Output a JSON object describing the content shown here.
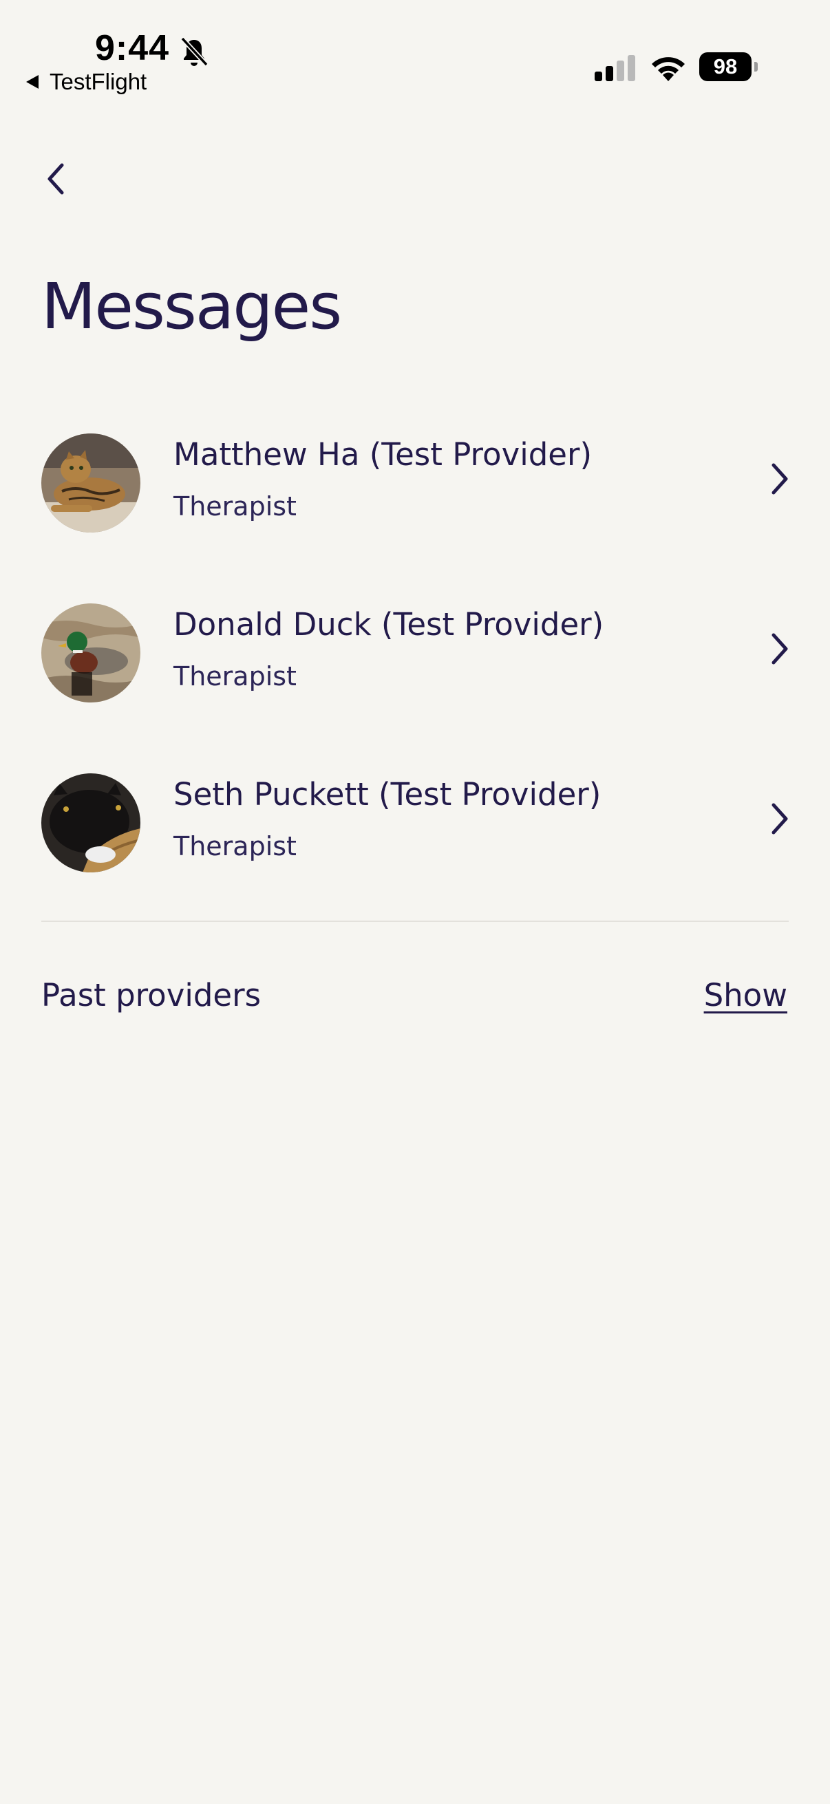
{
  "status_bar": {
    "time": "9:44",
    "back_app": "TestFlight",
    "battery": "98",
    "icons": [
      "bell-slash-icon",
      "cellular-signal-icon",
      "wifi-icon",
      "battery-icon"
    ]
  },
  "nav": {
    "back_icon": "chevron-left-icon"
  },
  "page": {
    "title": "Messages"
  },
  "providers": [
    {
      "name": "Matthew Ha (Test Provider)",
      "role": "Therapist",
      "avatar": "cat-photo"
    },
    {
      "name": "Donald Duck (Test Provider)",
      "role": "Therapist",
      "avatar": "duck-photo"
    },
    {
      "name": "Seth Puckett (Test Provider)",
      "role": "Therapist",
      "avatar": "black-cat-photo"
    }
  ],
  "past_providers": {
    "label": "Past providers",
    "action": "Show"
  },
  "colors": {
    "background": "#f6f5f1",
    "text": "#221a4a",
    "divider": "#e3e1dc"
  }
}
